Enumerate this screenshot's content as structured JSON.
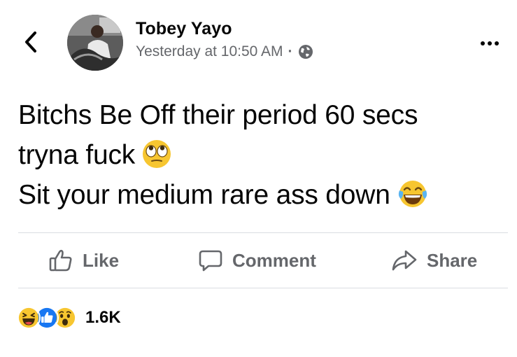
{
  "header": {
    "back_icon": "chevron-left-icon",
    "author_name": "Tobey Yayo",
    "timestamp": "Yesterday at 10:50 AM",
    "separator": "·",
    "privacy_icon": "globe-icon",
    "more_icon": "more-horizontal-icon"
  },
  "post": {
    "line_1": "Bitchs Be Off their period 60 secs",
    "line_2": "tryna fuck",
    "line_2_emoji": "face-with-rolling-eyes",
    "line_3": "Sit your medium rare ass down",
    "line_3_emoji": "face-with-tears-of-joy"
  },
  "actions": {
    "like_label": "Like",
    "comment_label": "Comment",
    "share_label": "Share"
  },
  "reactions": {
    "types": [
      "haha",
      "like",
      "wow"
    ],
    "count": "1.6K"
  },
  "colors": {
    "text_primary": "#050505",
    "text_secondary": "#65676b",
    "divider": "#dadde1",
    "like_blue": "#1877f2",
    "emoji_yellow": "#f7c630"
  }
}
